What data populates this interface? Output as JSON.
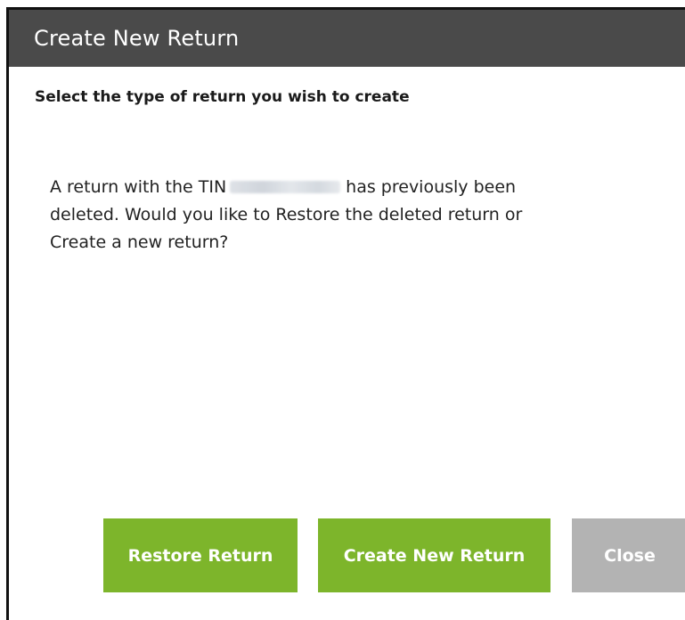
{
  "dialog": {
    "title": "Create New Return",
    "subtitle": "Select the type of return you wish to create",
    "message": {
      "line1_before_tin": "A return with the TIN",
      "tin_redacted": "",
      "line1_after_tin": "has previously been",
      "line2": "deleted. Would you like to Restore the deleted return or",
      "line3": "Create a new return?"
    },
    "buttons": {
      "restore_label": "Restore Return",
      "create_label": "Create New Return",
      "close_label": "Close"
    }
  },
  "colors": {
    "title_bar": "#4a4a4a",
    "primary_button": "#7db52b",
    "disabled_button": "#b3b3b3"
  }
}
